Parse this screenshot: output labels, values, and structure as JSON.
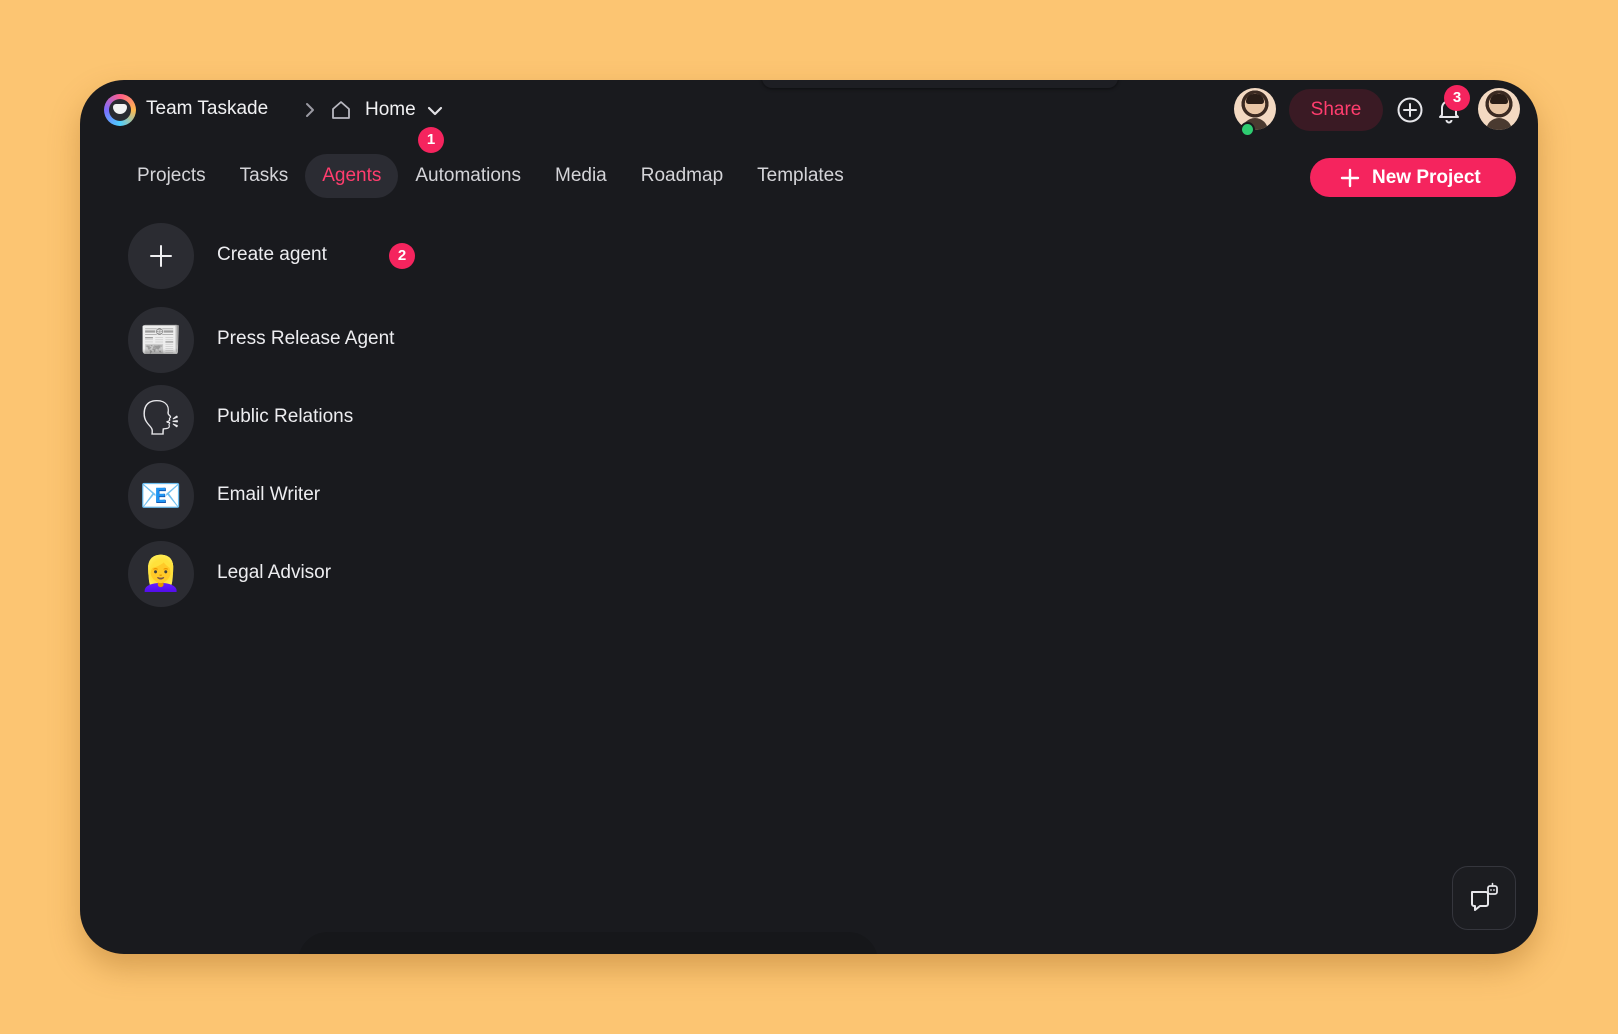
{
  "header": {
    "workspace_name": "Team Taskade",
    "breadcrumb_page": "Home",
    "share_label": "Share",
    "notification_count": "3",
    "tour_step_1": "1"
  },
  "tabs": [
    {
      "label": "Projects",
      "active": false
    },
    {
      "label": "Tasks",
      "active": false
    },
    {
      "label": "Agents",
      "active": true
    },
    {
      "label": "Automations",
      "active": false
    },
    {
      "label": "Media",
      "active": false
    },
    {
      "label": "Roadmap",
      "active": false
    },
    {
      "label": "Templates",
      "active": false
    }
  ],
  "new_project_label": "New Project",
  "agents": {
    "create_label": "Create agent",
    "create_step_badge": "2",
    "items": [
      {
        "label": "Press Release Agent",
        "icon": "newspaper-icon",
        "emoji": "📰"
      },
      {
        "label": "Public Relations",
        "icon": "speaking-head-icon",
        "emoji": "🗣"
      },
      {
        "label": "Email Writer",
        "icon": "email-envelope-icon",
        "emoji": "📧"
      },
      {
        "label": "Legal Advisor",
        "icon": "woman-blond-icon",
        "emoji": "👱‍♀️"
      }
    ]
  },
  "colors": {
    "accent": "#f5245e",
    "background": "#191a1e",
    "page_bg": "#fcc572"
  }
}
